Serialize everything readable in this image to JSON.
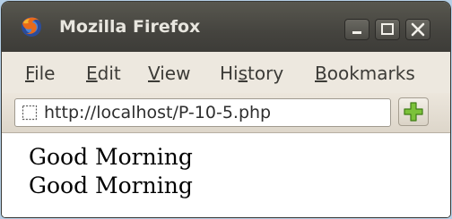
{
  "window": {
    "title": "Mozilla Firefox"
  },
  "menu": {
    "items": [
      {
        "label": "File",
        "accesskey": "F"
      },
      {
        "label": "Edit",
        "accesskey": "E"
      },
      {
        "label": "View",
        "accesskey": "V"
      },
      {
        "label": "History",
        "accesskey": "s"
      },
      {
        "label": "Bookmarks",
        "accesskey": "B"
      }
    ]
  },
  "navbar": {
    "url": "http://localhost/P-10-5.php",
    "page_icon": "blank-page-icon",
    "new_tab_icon": "plus-icon"
  },
  "page": {
    "lines": [
      "Good Morning",
      "Good Morning"
    ]
  },
  "colors": {
    "titlebar": "#45443f",
    "menubar": "#ede8df",
    "accent_plus": "#7cc23a"
  }
}
